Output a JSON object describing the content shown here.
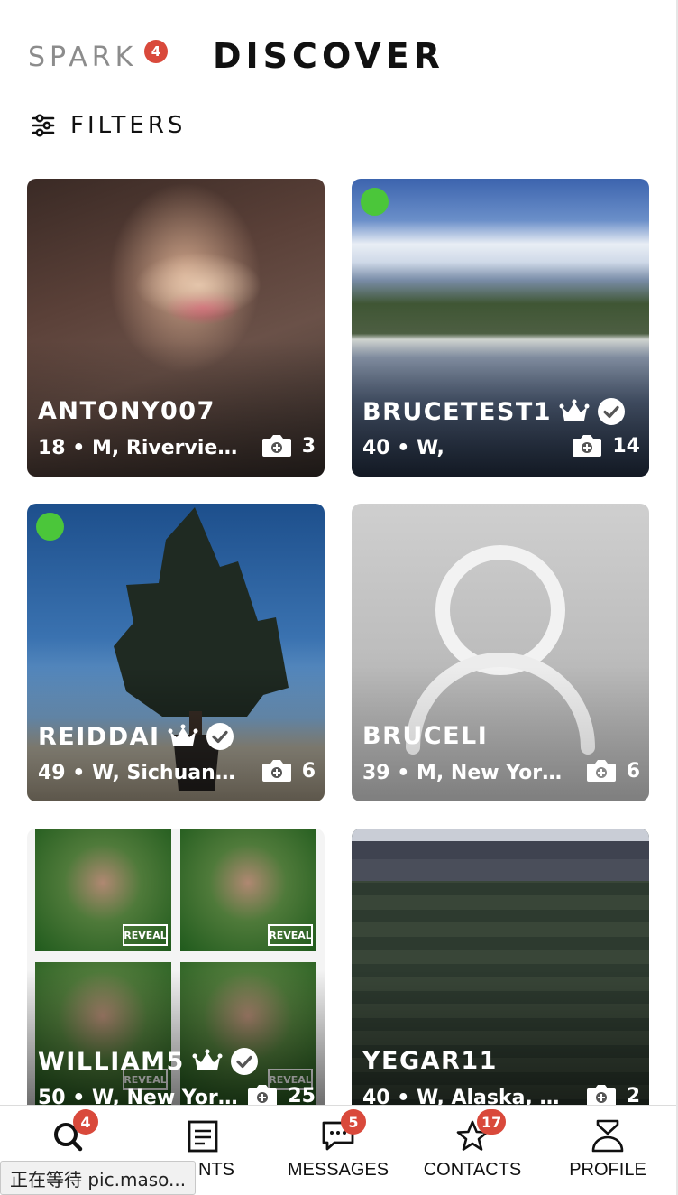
{
  "header": {
    "brand": "SPARK",
    "brand_badge": "4",
    "title": "DISCOVER",
    "filters_label": "FILTERS"
  },
  "cards": [
    {
      "name": "ANTONY007",
      "meta": "18 • M, Riverview,...",
      "photos": "3",
      "online": false,
      "crown": false,
      "verified": false
    },
    {
      "name": "BRUCETEST1",
      "meta": "40 • W,",
      "photos": "14",
      "online": true,
      "crown": true,
      "verified": true
    },
    {
      "name": "REIDDAI",
      "meta": "49 • W, Sichuan, C...",
      "photos": "6",
      "online": true,
      "crown": true,
      "verified": true
    },
    {
      "name": "BRUCELI",
      "meta": "39 • M, New York,...",
      "photos": "6",
      "online": false,
      "crown": false,
      "verified": false
    },
    {
      "name": "WILLIAM5",
      "meta": "50 • W, New York,...",
      "photos": "25",
      "online": false,
      "crown": true,
      "verified": true,
      "reveal_label": "REVEAL"
    },
    {
      "name": "YEGAR11",
      "meta": "40 • W, Alaska, Un...",
      "photos": "2",
      "online": false,
      "crown": false,
      "verified": false
    }
  ],
  "nav": {
    "items": [
      {
        "label": "",
        "icon": "search-icon",
        "badge": "4"
      },
      {
        "label": "NTS",
        "icon": "moments-icon",
        "badge": ""
      },
      {
        "label": "MESSAGES",
        "icon": "chat-icon",
        "badge": "5"
      },
      {
        "label": "CONTACTS",
        "icon": "star-icon",
        "badge": "17"
      },
      {
        "label": "PROFILE",
        "icon": "profile-icon",
        "badge": ""
      }
    ]
  },
  "status_tip": "正在等待 pic.maso...",
  "colors": {
    "badge": "#d9493b",
    "online": "#4bc63a"
  }
}
